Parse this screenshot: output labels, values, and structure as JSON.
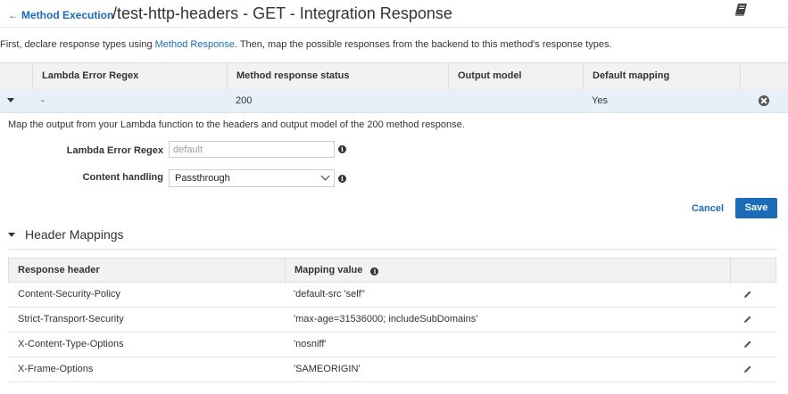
{
  "header": {
    "back_label": "Method Execution",
    "title": "/test-http-headers - GET - Integration Response"
  },
  "intro": {
    "prefix": "First, declare response types using ",
    "link": "Method Response",
    "suffix": ". Then, map the possible responses from the backend to this method's response types."
  },
  "main_table": {
    "columns": [
      "Lambda Error Regex",
      "Method response status",
      "Output model",
      "Default mapping"
    ],
    "row": {
      "regex": "-",
      "status": "200",
      "output_model": "",
      "default_mapping": "Yes"
    }
  },
  "detail": {
    "description": "Map the output from your Lambda function to the headers and output model of the 200 method response.",
    "regex_label": "Lambda Error Regex",
    "regex_placeholder": "default",
    "content_label": "Content handling",
    "content_value": "Passthrough",
    "cancel_label": "Cancel",
    "save_label": "Save"
  },
  "header_mappings": {
    "title": "Header Mappings",
    "columns": [
      "Response header",
      "Mapping value"
    ],
    "rows": [
      {
        "header": "Content-Security-Policy",
        "value": "'default-src 'self''"
      },
      {
        "header": "Strict-Transport-Security",
        "value": "'max-age=31536000; includeSubDomains'"
      },
      {
        "header": "X-Content-Type-Options",
        "value": "'nosniff'"
      },
      {
        "header": "X-Frame-Options",
        "value": "'SAMEORIGIN'"
      }
    ]
  },
  "icons": {
    "back": "arrow-left-icon",
    "book": "book-icon",
    "info": "info-icon",
    "edit": "pencil-icon",
    "remove": "close-circle-icon",
    "expand": "caret-down-icon"
  },
  "colors": {
    "accent": "#1a6bb8",
    "selected_row": "#e7f0f9",
    "header_bg": "#f2f2f2"
  }
}
